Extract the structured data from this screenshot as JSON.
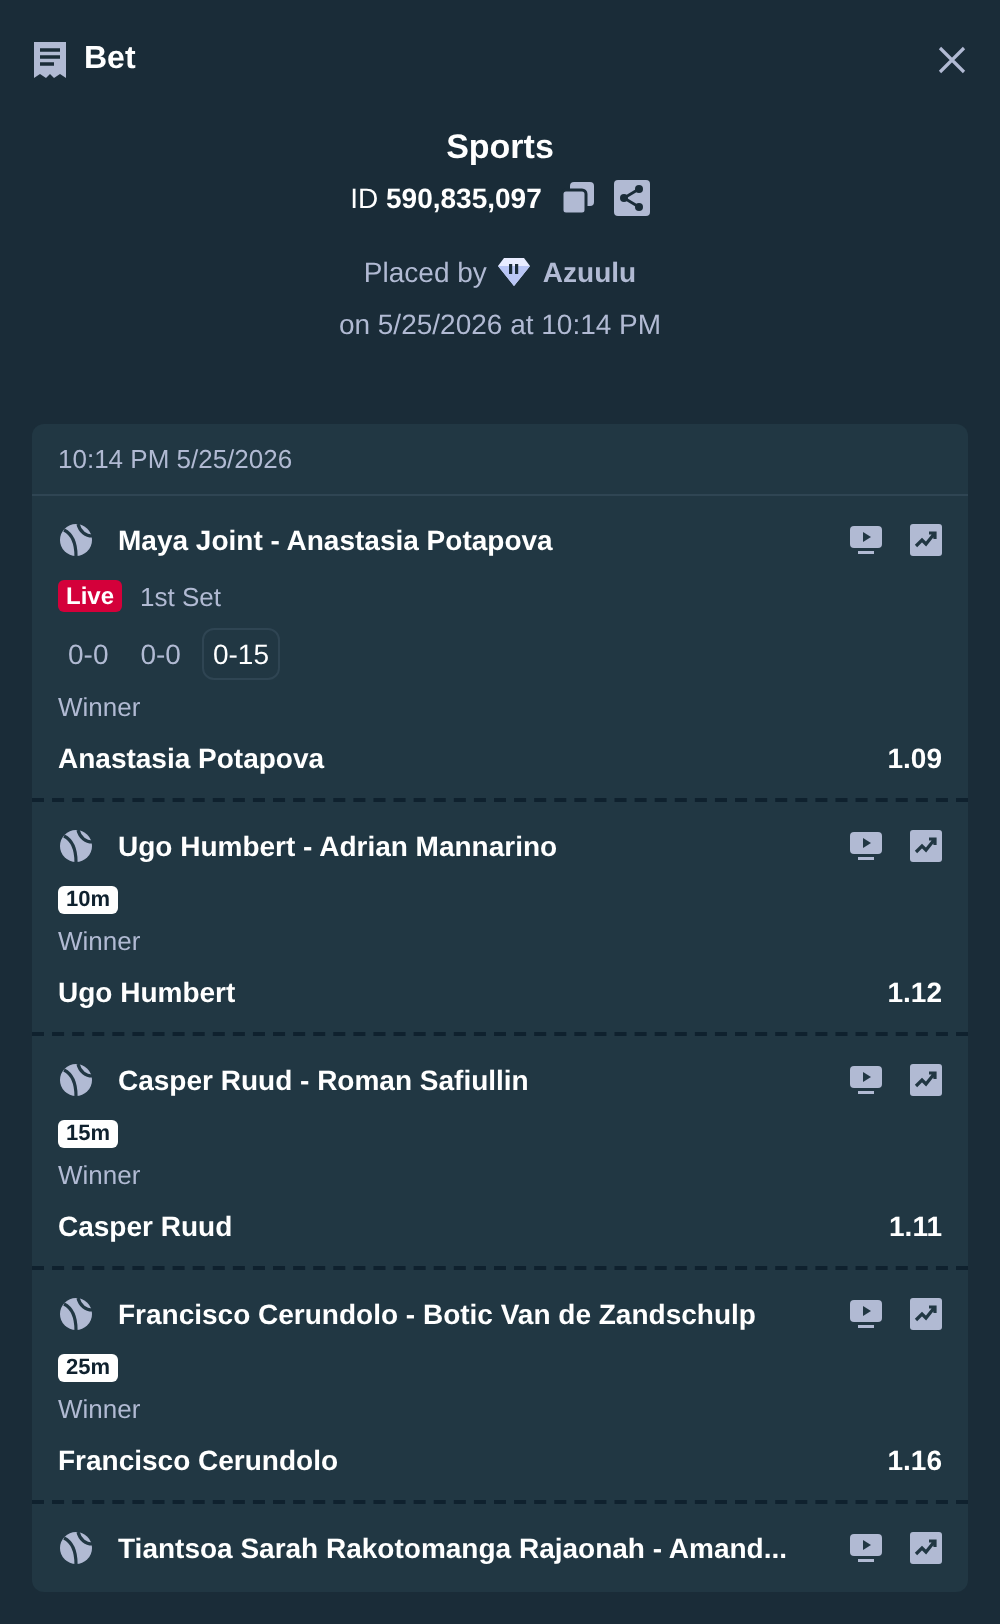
{
  "header": {
    "title": "Bet"
  },
  "summary": {
    "title": "Sports",
    "id_label": "ID",
    "id_value": "590,835,097",
    "placed_by": "Placed by",
    "user": "Azuulu",
    "date": "on 5/25/2026 at 10:14 PM"
  },
  "slip": {
    "time": "10:14 PM 5/25/2026",
    "legs": [
      {
        "event": "Maya Joint - Anastasia Potapova",
        "status": {
          "kind": "live",
          "badge": "Live",
          "period": "1st Set",
          "scores": [
            {
              "text": "0-0",
              "selected": false
            },
            {
              "text": "0-0",
              "selected": false
            },
            {
              "text": "0-15",
              "selected": true
            }
          ]
        },
        "market": "Winner",
        "pick": "Anastasia Potapova",
        "odds": "1.09"
      },
      {
        "event": "Ugo Humbert - Adrian Mannarino",
        "status": {
          "kind": "countdown",
          "badge": "10m"
        },
        "market": "Winner",
        "pick": "Ugo Humbert",
        "odds": "1.12"
      },
      {
        "event": "Casper Ruud - Roman Safiullin",
        "status": {
          "kind": "countdown",
          "badge": "15m"
        },
        "market": "Winner",
        "pick": "Casper Ruud",
        "odds": "1.11"
      },
      {
        "event": "Francisco Cerundolo - Botic Van de Zandschulp",
        "status": {
          "kind": "countdown",
          "badge": "25m"
        },
        "market": "Winner",
        "pick": "Francisco Cerundolo",
        "odds": "1.16"
      },
      {
        "event": "Tiantsoa Sarah Rakotomanga Rajaonah - Amand..."
      }
    ]
  }
}
